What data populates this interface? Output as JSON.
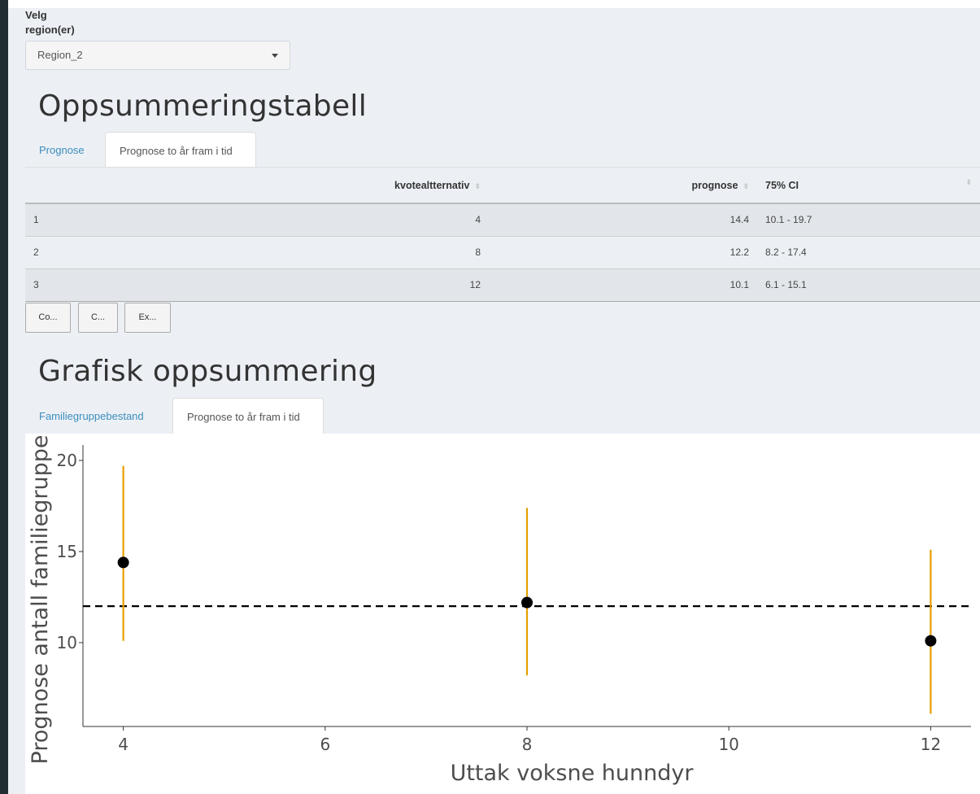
{
  "region": {
    "label": "Velg region(er)",
    "selected": "Region_2"
  },
  "summary": {
    "title": "Oppsummeringstabell",
    "tabs": [
      {
        "label": "Prognose",
        "active": false
      },
      {
        "label": "Prognose to år fram i tid",
        "active": true
      }
    ],
    "columns": [
      "",
      "kvotealtternativ",
      "prognose",
      "75% CI"
    ],
    "rows": [
      {
        "index": "1",
        "kvote": "4",
        "prognose": "14.4",
        "ci": "10.1 - 19.7"
      },
      {
        "index": "2",
        "kvote": "8",
        "prognose": "12.2",
        "ci": "8.2 - 17.4"
      },
      {
        "index": "3",
        "kvote": "12",
        "prognose": "10.1",
        "ci": "6.1 - 15.1"
      }
    ],
    "buttons": [
      "Co...",
      "C...",
      "Ex..."
    ]
  },
  "graphic": {
    "title": "Grafisk oppsummering",
    "tabs": [
      {
        "label": "Familiegruppebestand",
        "active": false
      },
      {
        "label": "Prognose to år fram i tid",
        "active": true
      }
    ]
  },
  "colors": {
    "errorbar": "#e69f00",
    "point": "#000000",
    "reference_line": "#000000"
  },
  "chart_data": {
    "type": "scatter",
    "title": "",
    "xlabel": "Uttak voksne hunndyr",
    "ylabel": "Prognose antall familiegruppe",
    "xlim": [
      3.6,
      12.4
    ],
    "ylim": [
      5.4,
      20.4
    ],
    "xticks": [
      4,
      6,
      8,
      10,
      12
    ],
    "yticks": [
      10,
      15,
      20
    ],
    "reference_y": 12,
    "grid": false,
    "points": [
      {
        "x": 4,
        "y": 14.4,
        "lo": 10.1,
        "hi": 19.7
      },
      {
        "x": 8,
        "y": 12.2,
        "lo": 8.2,
        "hi": 17.4
      },
      {
        "x": 12,
        "y": 10.1,
        "lo": 6.1,
        "hi": 15.1
      }
    ]
  }
}
